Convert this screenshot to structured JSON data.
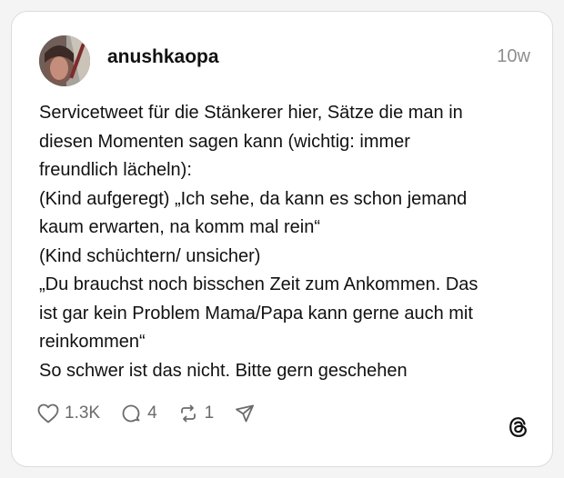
{
  "post": {
    "author": {
      "username": "anushkaopa",
      "avatar_icon": "avatar-photo"
    },
    "timestamp": "10w",
    "lines": [
      "Servicetweet für die Stänkerer hier, Sätze die man in",
      "diesen Momenten sagen kann (wichtig: immer",
      "freundlich lächeln):",
      "(Kind aufgeregt) „Ich sehe, da kann es schon jemand",
      "kaum erwarten, na komm mal rein“",
      "(Kind schüchtern/ unsicher)",
      "„Du brauchst noch bisschen Zeit zum Ankommen. Das",
      "ist gar kein Problem Mama/Papa kann gerne auch mit",
      "reinkommen“",
      "So schwer ist das nicht. Bitte gern geschehen"
    ],
    "actions": {
      "likes": "1.3K",
      "replies": "4",
      "reposts": "1",
      "icons": [
        "heart-icon",
        "comment-icon",
        "repost-icon",
        "share-icon"
      ]
    },
    "brand_icon": "threads-logo-icon"
  },
  "colors": {
    "background": "#f4f4f4",
    "card": "#ffffff",
    "text": "#111111",
    "muted": "#8e8e8e"
  }
}
